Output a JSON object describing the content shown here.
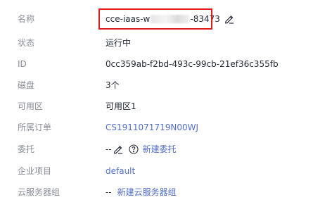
{
  "fields": {
    "name": {
      "label": "名称",
      "prefix": "cce-iaas-w",
      "suffix": "-83473"
    },
    "status": {
      "label": "状态",
      "value": "运行中"
    },
    "id": {
      "label": "ID",
      "value": "0cc359ab-f2bd-493c-99cb-21ef36c355fb"
    },
    "disk": {
      "label": "磁盘",
      "value": "3个"
    },
    "az": {
      "label": "可用区",
      "value": "可用区1"
    },
    "order": {
      "label": "所属订单",
      "value": "CS1911071719N00WJ"
    },
    "agency": {
      "label": "委托",
      "value": "--",
      "create_link": "新建委托"
    },
    "enterprise_project": {
      "label": "企业项目",
      "value": "default"
    },
    "server_group": {
      "label": "云服务器组",
      "value": "--",
      "create_link": "新建云服务器组"
    }
  },
  "colors": {
    "label": "#8a8e99",
    "text": "#252b3a",
    "link": "#526ecc",
    "highlight": "#e01a1a"
  },
  "icons": {
    "name_edit": "pencil-edit-icon",
    "agency_edit": "pencil-edit-icon",
    "agency_help": "question-circle-icon"
  }
}
